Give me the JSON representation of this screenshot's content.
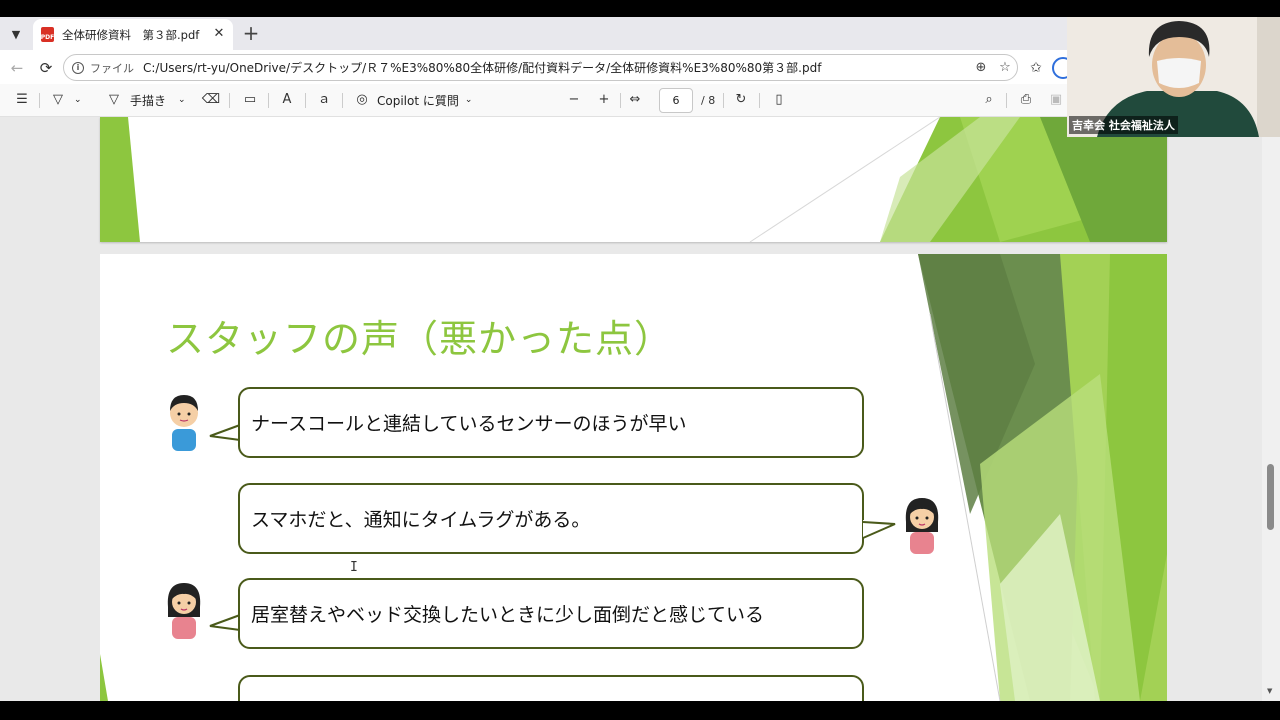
{
  "tab": {
    "title": "全体研修資料　第３部.pdf",
    "pdf_badge": "PDF"
  },
  "address": {
    "prefix": "ファイル",
    "url": "C:/Users/rt-yu/OneDrive/デスクトップ/Ｒ７%E3%80%80全体研修/配付資料データ/全体研修資料%E3%80%80第３部.pdf"
  },
  "pdf_toolbar": {
    "draw_label": "手描き",
    "copilot_label": "Copilot に質問",
    "page_current": "6",
    "page_total": "/ 8"
  },
  "slide": {
    "title": "スタッフの声（悪かった点）",
    "comments": [
      {
        "text": "ナースコールと連結しているセンサーのほうが早い",
        "speaker": "male"
      },
      {
        "text": "スマホだと、通知にタイムラグがある。",
        "speaker": "female"
      },
      {
        "text": "居室替えやベッド交換したいときに少し面倒だと感じている",
        "speaker": "female"
      },
      {
        "text": "",
        "speaker": ""
      }
    ]
  },
  "webcam": {
    "label": "吉幸会 社会福祉法人"
  },
  "colors": {
    "title_green": "#8dc63f",
    "bubble_border": "#4a5a1a",
    "accent_blue": "#2f6fdc"
  }
}
